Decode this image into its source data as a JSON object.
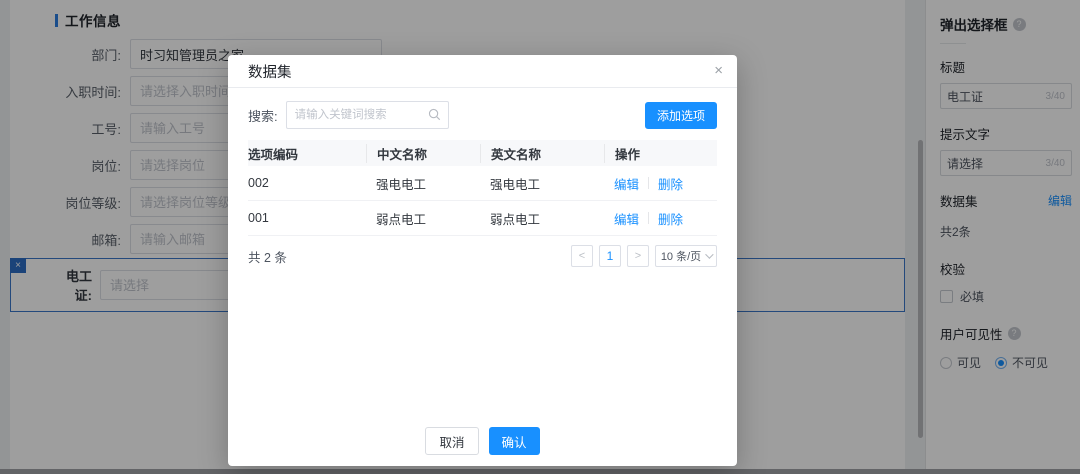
{
  "colors": {
    "accent": "#1890ff",
    "selected_widget_border": "#3a77c8"
  },
  "icons": {
    "close": "×",
    "help": "?",
    "widget_close": "×"
  },
  "main_form": {
    "section_title": "工作信息",
    "fields": [
      {
        "label": "部门:",
        "value": "时习知管理员之家",
        "placeholder": ""
      },
      {
        "label": "入职时间:",
        "value": "",
        "placeholder": "请选择入职时间"
      },
      {
        "label": "工号:",
        "value": "",
        "placeholder": "请输入工号"
      },
      {
        "label": "岗位:",
        "value": "",
        "placeholder": "请选择岗位"
      },
      {
        "label": "岗位等级:",
        "value": "",
        "placeholder": "请选择岗位等级"
      },
      {
        "label": "邮箱:",
        "value": "",
        "placeholder": "请输入邮箱"
      }
    ]
  },
  "widget": {
    "label": "电工证:",
    "placeholder": "请选择",
    "close_icon": "×"
  },
  "modal": {
    "title": "数据集",
    "close_icon": "×",
    "search_label": "搜索:",
    "search_placeholder": "请输入关键词搜索",
    "add_button": "添加选项",
    "table": {
      "headers": [
        "选项编码",
        "中文名称",
        "英文名称",
        "操作"
      ],
      "edit_label": "编辑",
      "delete_label": "删除",
      "rows": [
        [
          "002",
          "强电电工",
          "强电电工"
        ],
        [
          "001",
          "弱点电工",
          "弱点电工"
        ]
      ]
    },
    "total": "共 2 条",
    "pagination": {
      "prev": "<",
      "page": "1",
      "next": ">",
      "page_size": "10 条/页"
    },
    "cancel_button": "取消",
    "confirm_button": "确认"
  },
  "sidebar": {
    "title": "弹出选择框",
    "title_field": {
      "label": "标题",
      "value": "电工证",
      "counter": "3/40"
    },
    "prompt_field": {
      "label": "提示文字",
      "value": "请选择",
      "counter": "3/40"
    },
    "dataset": {
      "label": "数据集",
      "edit_link": "编辑",
      "count": "共2条"
    },
    "validation": {
      "label": "校验",
      "checkbox_label": "必填",
      "checked": false
    },
    "visibility": {
      "label": "用户可见性",
      "options": [
        {
          "label": "可见",
          "selected": false
        },
        {
          "label": "不可见",
          "selected": true
        }
      ]
    }
  }
}
